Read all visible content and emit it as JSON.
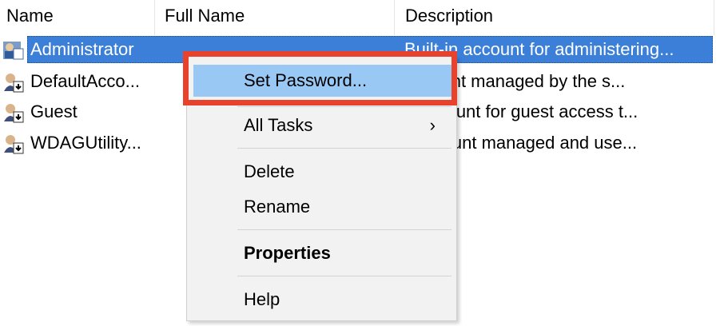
{
  "columns": {
    "name": "Name",
    "full_name": "Full Name",
    "description": "Description"
  },
  "users": [
    {
      "name": "Administrator",
      "full_name": "",
      "description": "Built-in account for administering...",
      "selected": true
    },
    {
      "name": "DefaultAcco...",
      "full_name": "",
      "description": "account managed by the s..."
    },
    {
      "name": "Guest",
      "full_name": "",
      "description": "n account for guest access t..."
    },
    {
      "name": "WDAGUtility...",
      "full_name": "",
      "description": "r account managed and use..."
    }
  ],
  "context_menu": {
    "set_password": "Set Password...",
    "all_tasks": "All Tasks",
    "submenu_arrow": "›",
    "delete": "Delete",
    "rename": "Rename",
    "properties": "Properties",
    "help": "Help"
  },
  "colors": {
    "selection": "#3b7fd8",
    "menu_hover": "#9ac8f5",
    "highlight_box": "#e8412c",
    "menu_bg": "#f2f2f2"
  },
  "icons": {
    "user": "user-account-icon",
    "submenu": "chevron-right-icon"
  }
}
